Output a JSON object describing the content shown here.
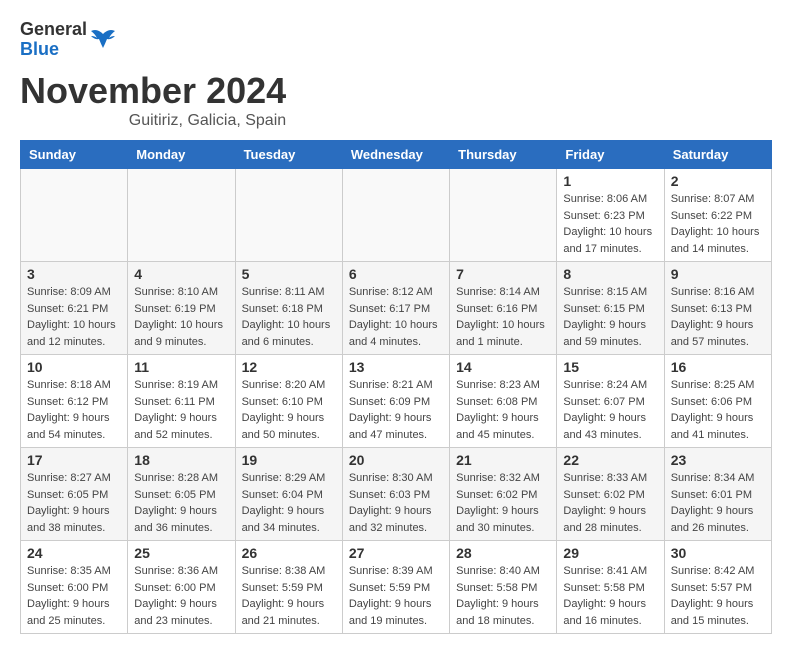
{
  "header": {
    "logo_general": "General",
    "logo_blue": "Blue",
    "month_title": "November 2024",
    "location": "Guitiriz, Galicia, Spain"
  },
  "weekdays": [
    "Sunday",
    "Monday",
    "Tuesday",
    "Wednesday",
    "Thursday",
    "Friday",
    "Saturday"
  ],
  "weeks": [
    [
      {
        "day": "",
        "info": ""
      },
      {
        "day": "",
        "info": ""
      },
      {
        "day": "",
        "info": ""
      },
      {
        "day": "",
        "info": ""
      },
      {
        "day": "",
        "info": ""
      },
      {
        "day": "1",
        "info": "Sunrise: 8:06 AM\nSunset: 6:23 PM\nDaylight: 10 hours and 17 minutes."
      },
      {
        "day": "2",
        "info": "Sunrise: 8:07 AM\nSunset: 6:22 PM\nDaylight: 10 hours and 14 minutes."
      }
    ],
    [
      {
        "day": "3",
        "info": "Sunrise: 8:09 AM\nSunset: 6:21 PM\nDaylight: 10 hours and 12 minutes."
      },
      {
        "day": "4",
        "info": "Sunrise: 8:10 AM\nSunset: 6:19 PM\nDaylight: 10 hours and 9 minutes."
      },
      {
        "day": "5",
        "info": "Sunrise: 8:11 AM\nSunset: 6:18 PM\nDaylight: 10 hours and 6 minutes."
      },
      {
        "day": "6",
        "info": "Sunrise: 8:12 AM\nSunset: 6:17 PM\nDaylight: 10 hours and 4 minutes."
      },
      {
        "day": "7",
        "info": "Sunrise: 8:14 AM\nSunset: 6:16 PM\nDaylight: 10 hours and 1 minute."
      },
      {
        "day": "8",
        "info": "Sunrise: 8:15 AM\nSunset: 6:15 PM\nDaylight: 9 hours and 59 minutes."
      },
      {
        "day": "9",
        "info": "Sunrise: 8:16 AM\nSunset: 6:13 PM\nDaylight: 9 hours and 57 minutes."
      }
    ],
    [
      {
        "day": "10",
        "info": "Sunrise: 8:18 AM\nSunset: 6:12 PM\nDaylight: 9 hours and 54 minutes."
      },
      {
        "day": "11",
        "info": "Sunrise: 8:19 AM\nSunset: 6:11 PM\nDaylight: 9 hours and 52 minutes."
      },
      {
        "day": "12",
        "info": "Sunrise: 8:20 AM\nSunset: 6:10 PM\nDaylight: 9 hours and 50 minutes."
      },
      {
        "day": "13",
        "info": "Sunrise: 8:21 AM\nSunset: 6:09 PM\nDaylight: 9 hours and 47 minutes."
      },
      {
        "day": "14",
        "info": "Sunrise: 8:23 AM\nSunset: 6:08 PM\nDaylight: 9 hours and 45 minutes."
      },
      {
        "day": "15",
        "info": "Sunrise: 8:24 AM\nSunset: 6:07 PM\nDaylight: 9 hours and 43 minutes."
      },
      {
        "day": "16",
        "info": "Sunrise: 8:25 AM\nSunset: 6:06 PM\nDaylight: 9 hours and 41 minutes."
      }
    ],
    [
      {
        "day": "17",
        "info": "Sunrise: 8:27 AM\nSunset: 6:05 PM\nDaylight: 9 hours and 38 minutes."
      },
      {
        "day": "18",
        "info": "Sunrise: 8:28 AM\nSunset: 6:05 PM\nDaylight: 9 hours and 36 minutes."
      },
      {
        "day": "19",
        "info": "Sunrise: 8:29 AM\nSunset: 6:04 PM\nDaylight: 9 hours and 34 minutes."
      },
      {
        "day": "20",
        "info": "Sunrise: 8:30 AM\nSunset: 6:03 PM\nDaylight: 9 hours and 32 minutes."
      },
      {
        "day": "21",
        "info": "Sunrise: 8:32 AM\nSunset: 6:02 PM\nDaylight: 9 hours and 30 minutes."
      },
      {
        "day": "22",
        "info": "Sunrise: 8:33 AM\nSunset: 6:02 PM\nDaylight: 9 hours and 28 minutes."
      },
      {
        "day": "23",
        "info": "Sunrise: 8:34 AM\nSunset: 6:01 PM\nDaylight: 9 hours and 26 minutes."
      }
    ],
    [
      {
        "day": "24",
        "info": "Sunrise: 8:35 AM\nSunset: 6:00 PM\nDaylight: 9 hours and 25 minutes."
      },
      {
        "day": "25",
        "info": "Sunrise: 8:36 AM\nSunset: 6:00 PM\nDaylight: 9 hours and 23 minutes."
      },
      {
        "day": "26",
        "info": "Sunrise: 8:38 AM\nSunset: 5:59 PM\nDaylight: 9 hours and 21 minutes."
      },
      {
        "day": "27",
        "info": "Sunrise: 8:39 AM\nSunset: 5:59 PM\nDaylight: 9 hours and 19 minutes."
      },
      {
        "day": "28",
        "info": "Sunrise: 8:40 AM\nSunset: 5:58 PM\nDaylight: 9 hours and 18 minutes."
      },
      {
        "day": "29",
        "info": "Sunrise: 8:41 AM\nSunset: 5:58 PM\nDaylight: 9 hours and 16 minutes."
      },
      {
        "day": "30",
        "info": "Sunrise: 8:42 AM\nSunset: 5:57 PM\nDaylight: 9 hours and 15 minutes."
      }
    ]
  ]
}
